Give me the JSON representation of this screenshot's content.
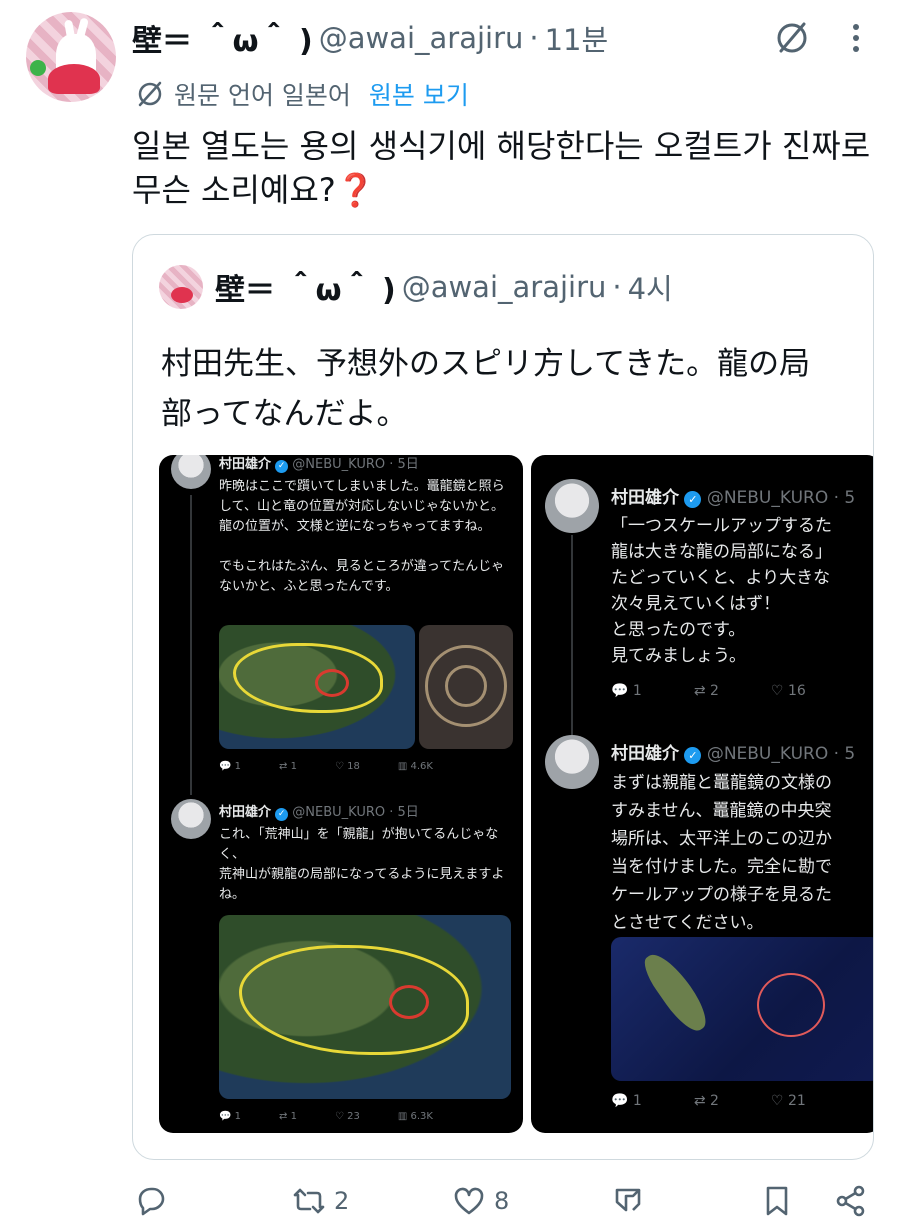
{
  "tweet": {
    "display_name": "壁＝ ＾ω＾ )",
    "handle": "@awai_arajiru",
    "separator": "·",
    "time": "11분",
    "translation": {
      "source_language": "원문 언어 일본어",
      "show_original": "원본 보기"
    },
    "text": "일본 열도는 용의 생식기에 해당한다는 오컬트가 진짜로 무슨 소리예요?❓"
  },
  "quote": {
    "display_name": "壁＝ ＾ω＾ )",
    "handle": "@awai_arajiru",
    "separator": "·",
    "time": "4시",
    "text": "村田先生、予想外のスピリ方してきた。龍の局部ってなんだよ。"
  },
  "screenshot_left": {
    "post1": {
      "name": "村田雄介",
      "handle": "@NEBU_KURO · 5日",
      "text": "昨晩はここで躓いてしまいました。鼉龍鏡と照らして、山と竜の位置が対応しないじゃないかと。龍の位置が、文様と逆になっちゃってますね。\n\nでもこれはたぶん、見るところが違ってたんじゃないかと、ふと思ったんです。",
      "stats": {
        "replies": "1",
        "reposts": "1",
        "likes": "18",
        "views": "4.6K"
      }
    },
    "post2": {
      "name": "村田雄介",
      "handle": "@NEBU_KURO · 5日",
      "text": "これ、「荒神山」を「親龍」が抱いてるんじゃなく、\n荒神山が親龍の局部になってるように見えますよね。",
      "stats": {
        "replies": "1",
        "reposts": "1",
        "likes": "23",
        "views": "6.3K"
      }
    }
  },
  "screenshot_right": {
    "post1": {
      "name": "村田雄介",
      "handle": "@NEBU_KURO · 5",
      "text": "「一つスケールアップするた\n龍は大きな龍の局部になる」\nたどっていくと、より大きな\n次々見えていくはず！\nと思ったのです。\n見てみましょう。",
      "stats": {
        "replies": "1",
        "reposts": "2",
        "likes": "16"
      }
    },
    "post2": {
      "name": "村田雄介",
      "handle": "@NEBU_KURO · 5",
      "text": "まずは親龍と鼉龍鏡の文様の\nすみません、鼉龍鏡の中央突\n場所は、太平洋上のこの辺か\n当を付けました。完全に勘で\nケールアップの様子を見るた\nとさせてください。",
      "stats": {
        "replies": "1",
        "reposts": "2",
        "likes": "21"
      }
    }
  },
  "actions": {
    "replies": "",
    "reposts": "2",
    "likes": "8"
  },
  "colors": {
    "accent": "#1d9bf0",
    "text": "#0f1419",
    "muted": "#536471",
    "border": "#cfd9de"
  }
}
